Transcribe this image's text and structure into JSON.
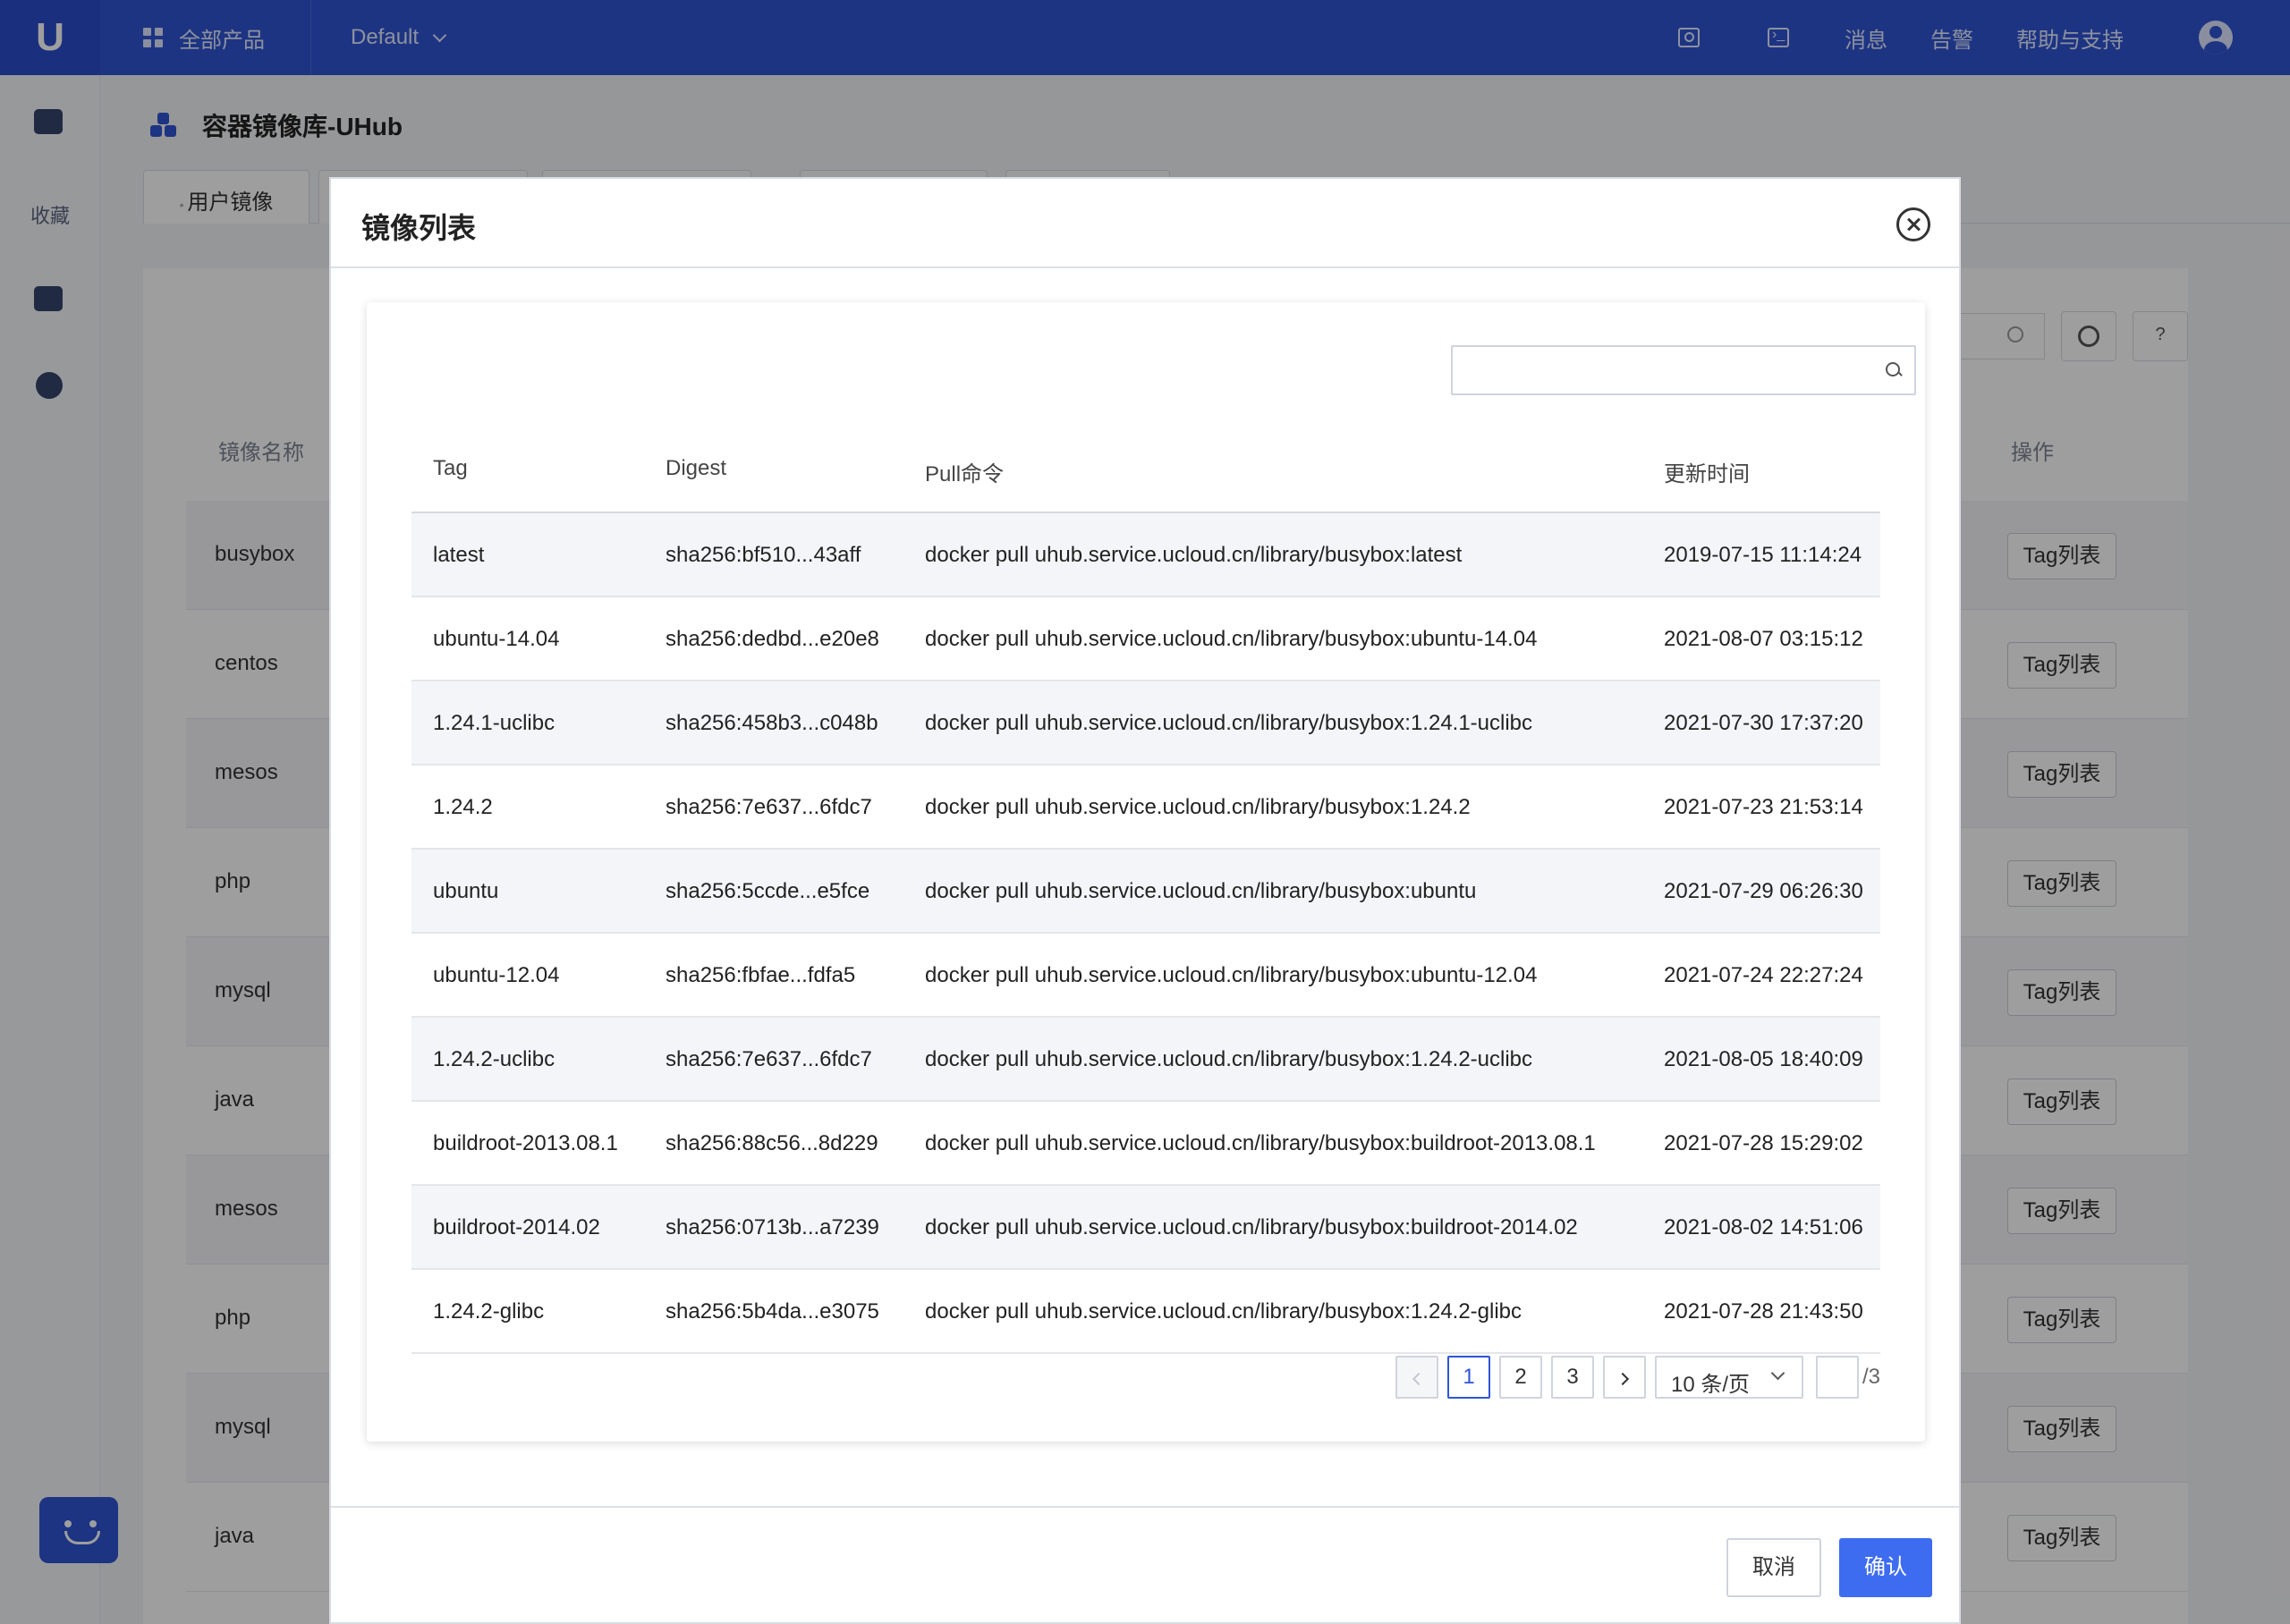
{
  "topbar": {
    "logo": "U",
    "products": "全部产品",
    "project": "Default",
    "links": [
      "消息",
      "告警",
      "帮助与支持"
    ]
  },
  "sidebar": {
    "favorites": "收藏"
  },
  "page": {
    "title": "容器镜像库-UHub",
    "tabs": [
      "用户镜像"
    ],
    "columns": {
      "name": "镜像名称",
      "actions": "操作"
    },
    "tag_button": "Tag列表",
    "rows": [
      "busybox",
      "centos",
      "mesos",
      "php",
      "mysql",
      "java",
      "mesos",
      "php",
      "mysql",
      "java"
    ]
  },
  "modal": {
    "title": "镜像列表",
    "search_placeholder": "",
    "columns": [
      "Tag",
      "Digest",
      "Pull命令",
      "更新时间"
    ],
    "rows": [
      {
        "tag": "latest",
        "digest": "sha256:bf510...43aff",
        "pull": "docker pull uhub.service.ucloud.cn/library/busybox:latest",
        "updated": "2019-07-15 11:14:24"
      },
      {
        "tag": "ubuntu-14.04",
        "digest": "sha256:dedbd...e20e8",
        "pull": "docker pull uhub.service.ucloud.cn/library/busybox:ubuntu-14.04",
        "updated": "2021-08-07 03:15:12"
      },
      {
        "tag": "1.24.1-uclibc",
        "digest": "sha256:458b3...c048b",
        "pull": "docker pull uhub.service.ucloud.cn/library/busybox:1.24.1-uclibc",
        "updated": "2021-07-30 17:37:20"
      },
      {
        "tag": "1.24.2",
        "digest": "sha256:7e637...6fdc7",
        "pull": "docker pull uhub.service.ucloud.cn/library/busybox:1.24.2",
        "updated": "2021-07-23 21:53:14"
      },
      {
        "tag": "ubuntu",
        "digest": "sha256:5ccde...e5fce",
        "pull": "docker pull uhub.service.ucloud.cn/library/busybox:ubuntu",
        "updated": "2021-07-29 06:26:30"
      },
      {
        "tag": "ubuntu-12.04",
        "digest": "sha256:fbfae...fdfa5",
        "pull": "docker pull uhub.service.ucloud.cn/library/busybox:ubuntu-12.04",
        "updated": "2021-07-24 22:27:24"
      },
      {
        "tag": "1.24.2-uclibc",
        "digest": "sha256:7e637...6fdc7",
        "pull": "docker pull uhub.service.ucloud.cn/library/busybox:1.24.2-uclibc",
        "updated": "2021-08-05 18:40:09"
      },
      {
        "tag": "buildroot-2013.08.1",
        "digest": "sha256:88c56...8d229",
        "pull": "docker pull uhub.service.ucloud.cn/library/busybox:buildroot-2013.08.1",
        "updated": "2021-07-28 15:29:02"
      },
      {
        "tag": "buildroot-2014.02",
        "digest": "sha256:0713b...a7239",
        "pull": "docker pull uhub.service.ucloud.cn/library/busybox:buildroot-2014.02",
        "updated": "2021-08-02 14:51:06"
      },
      {
        "tag": "1.24.2-glibc",
        "digest": "sha256:5b4da...e3075",
        "pull": "docker pull uhub.service.ucloud.cn/library/busybox:1.24.2-glibc",
        "updated": "2021-07-28 21:43:50"
      }
    ],
    "pagination": {
      "pages": [
        "1",
        "2",
        "3"
      ],
      "current": "1",
      "page_size": "10 条/页",
      "jump_value": "",
      "total": "/3"
    },
    "buttons": {
      "cancel": "取消",
      "ok": "确认"
    }
  },
  "colors": {
    "brand": "#2f55d4",
    "primary_button": "#3e6cf0"
  }
}
